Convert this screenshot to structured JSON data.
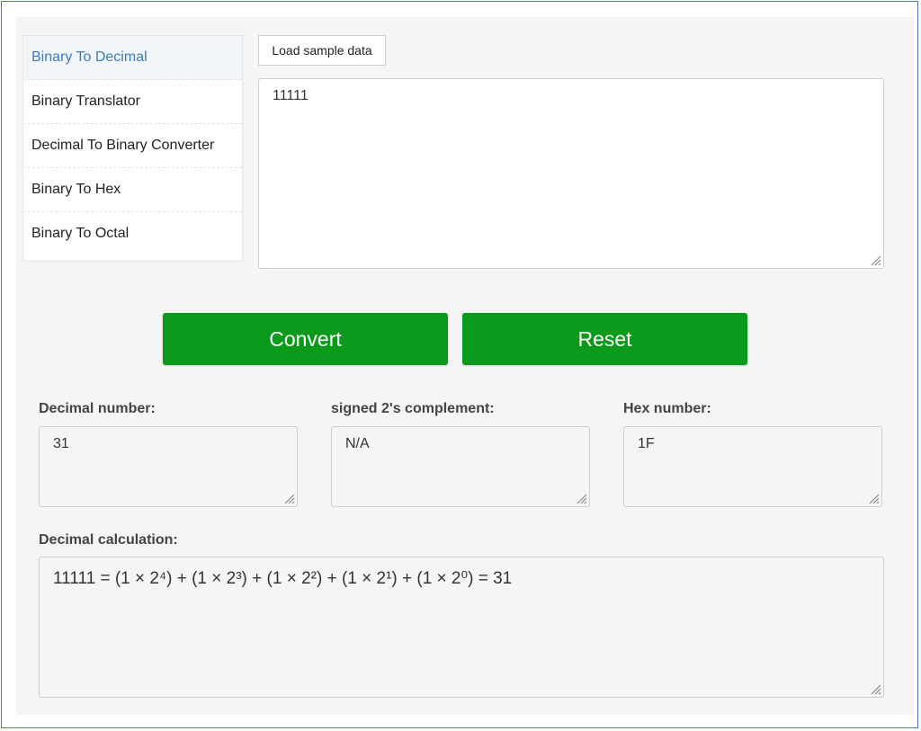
{
  "sidebar": {
    "items": [
      {
        "label": "Binary To Decimal",
        "active": true
      },
      {
        "label": "Binary Translator",
        "active": false
      },
      {
        "label": "Decimal To Binary Converter",
        "active": false
      },
      {
        "label": "Binary To Hex",
        "active": false
      },
      {
        "label": "Binary To Octal",
        "active": false
      }
    ]
  },
  "input": {
    "load_sample_label": "Load sample data",
    "value": "11111"
  },
  "actions": {
    "convert_label": "Convert",
    "reset_label": "Reset"
  },
  "outputs": {
    "decimal": {
      "label": "Decimal number:",
      "value": "31"
    },
    "twos_complement": {
      "label": "signed 2's complement:",
      "value": "N/A"
    },
    "hex": {
      "label": "Hex number:",
      "value": "1F"
    },
    "calculation": {
      "label": "Decimal calculation:",
      "value": "11111 = (1 × 2⁴) + (1 × 2³) + (1 × 2²) + (1 × 2¹) + (1 × 2⁰) = 31"
    }
  },
  "colors": {
    "button_green": "#0b9a1b",
    "active_link": "#3b7bc4",
    "frame_border": "#4b72c4"
  },
  "icons": [
    "resize-grip-icon"
  ]
}
